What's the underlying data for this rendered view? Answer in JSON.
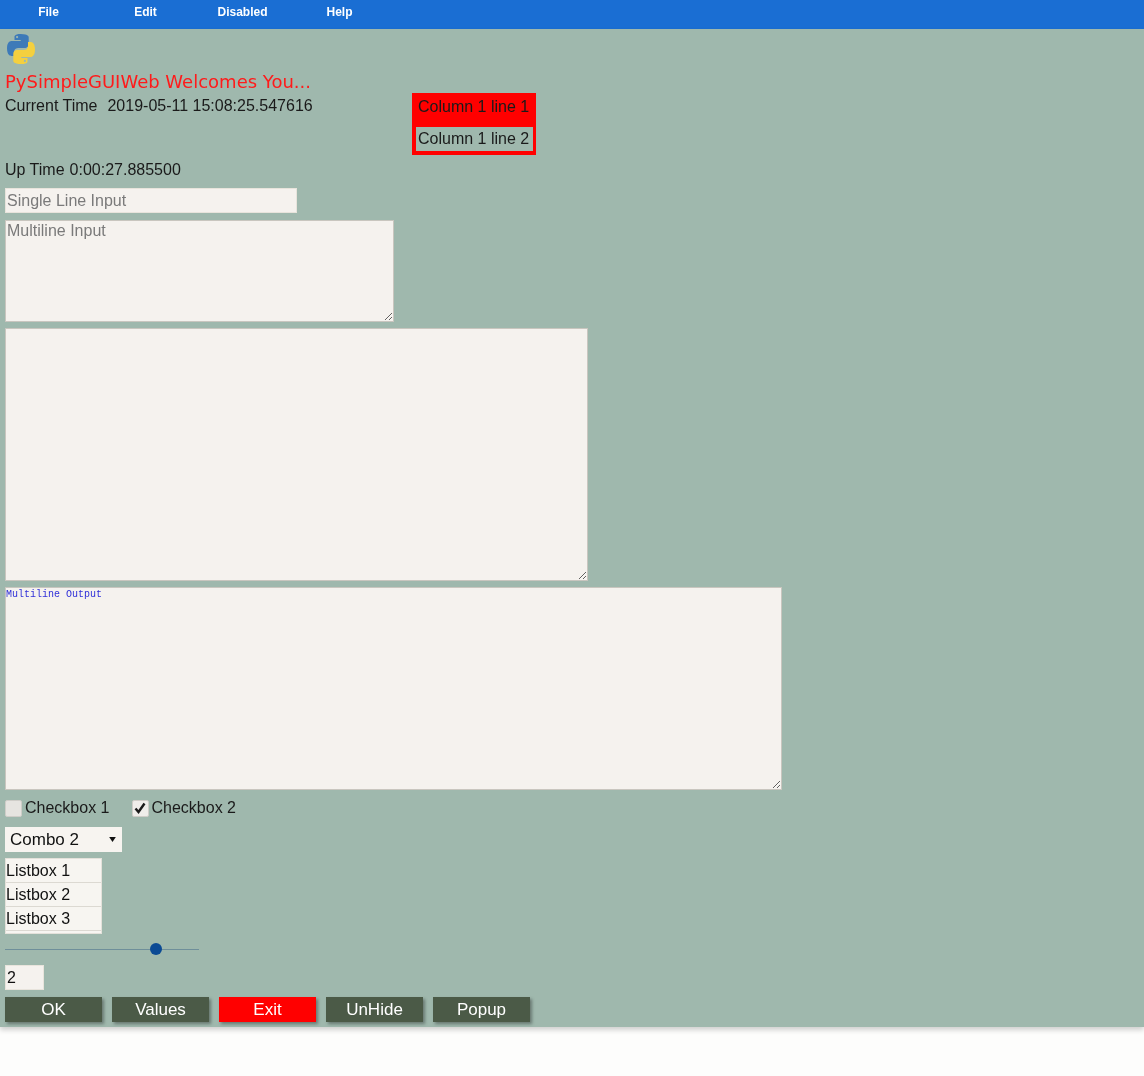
{
  "menu_bar": {
    "items": [
      "File",
      "Edit",
      "Disabled",
      "Help"
    ]
  },
  "title": "PySimpleGUIWeb Welcomes You...",
  "current_time": {
    "label": "Current Time",
    "value": "2019-05-11 15:08:25.547616"
  },
  "column": {
    "lines": [
      {
        "text": "Column 1 line 1",
        "color": "#ff0000"
      },
      {
        "text": "Column 1 line 2",
        "color": "#9fb8ad"
      }
    ]
  },
  "up_time": {
    "label": "Up Time",
    "value": "0:00:27.885500"
  },
  "single_line_input": {
    "placeholder": "Single Line Input"
  },
  "multiline_input": {
    "placeholder": "Multiline Input"
  },
  "multiline_output": {
    "value": "Multiline Output"
  },
  "checkboxes": [
    {
      "label": "Checkbox 1",
      "checked": false
    },
    {
      "label": "Checkbox 2",
      "checked": true
    }
  ],
  "combo": {
    "value": "Combo 2"
  },
  "listbox": {
    "items": [
      {
        "label": "Listbox 1",
        "selected": false
      },
      {
        "label": "Listbox 2",
        "selected": false
      },
      {
        "label": "Listbox 3",
        "selected": false
      }
    ]
  },
  "slider": {
    "level": 0.78
  },
  "spin": {
    "value": "2"
  },
  "buttons": [
    {
      "label": "OK",
      "color": "#4b5a47"
    },
    {
      "label": "Values",
      "color": "#4b5a47"
    },
    {
      "label": "Exit",
      "color": "#ff0000"
    },
    {
      "label": "UnHide",
      "color": "#4b5a47"
    },
    {
      "label": "Popup",
      "color": "#4b5a47"
    }
  ]
}
